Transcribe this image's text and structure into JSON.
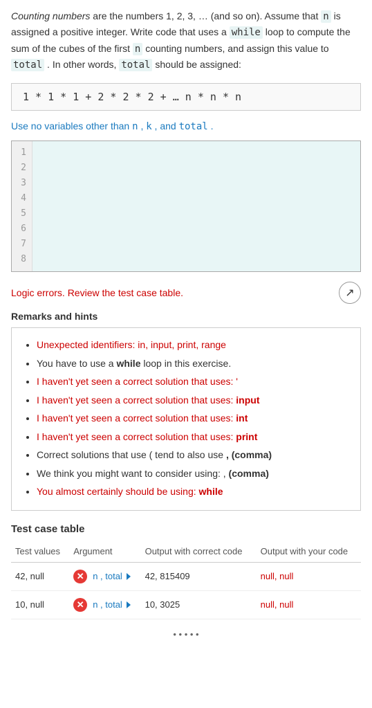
{
  "description": {
    "intro": "Counting numbers are the numbers 1, 2, 3, … (and so on). Assume that ",
    "var_n": "n",
    "mid": " is assigned a positive integer. Write code that uses a ",
    "while_kw": "while",
    "mid2": " loop to compute the sum of the cubes of the first ",
    "var_n2": "n",
    "mid3": " counting numbers, and assign this value to ",
    "total_kw": "total",
    "end": ". In other words, ",
    "total_kw2": "total",
    "end2": " should be assigned:"
  },
  "formula": "1 * 1 * 1 + 2 * 2 * 2 + … n * n * n",
  "constraint": {
    "prefix": "Use no variables other than ",
    "n": "n",
    "comma1": ",  ",
    "k": "k",
    "comma2": ", and ",
    "total": "total",
    "period": "."
  },
  "editor": {
    "lines": [
      "1",
      "2",
      "3",
      "4",
      "5",
      "6",
      "7",
      "8"
    ]
  },
  "error": {
    "text": "Logic errors. Review the test case table.",
    "expand_icon": "↗"
  },
  "remarks": {
    "title": "Remarks and hints",
    "items": [
      {
        "prefix": "Unexpected identifiers: ",
        "text": "in, input, print, range",
        "style": "red"
      },
      {
        "prefix": "You have to use a ",
        "bold": "while",
        "suffix": " loop in this exercise.",
        "style": "normal"
      },
      {
        "prefix": "I haven't yet seen a correct solution that uses: ",
        "text": "'",
        "style": "red"
      },
      {
        "prefix": "I haven't yet seen a correct solution that uses: ",
        "bold": "input",
        "style": "red"
      },
      {
        "prefix": "I haven't yet seen a correct solution that uses: ",
        "bold": "int",
        "style": "red"
      },
      {
        "prefix": "I haven't yet seen a correct solution that uses: ",
        "bold": "print",
        "style": "red"
      },
      {
        "prefix": "Correct solutions that use ",
        "text": "( tend to also use ",
        "bold2": ", (comma)",
        "style": "normal"
      },
      {
        "prefix": "We think you might want to consider using: ",
        "text": ", ",
        "bold2": "(comma)",
        "style": "normal"
      },
      {
        "prefix": "You almost certainly should be using: ",
        "bold": "while",
        "style": "red"
      }
    ]
  },
  "test_table": {
    "title": "Test case table",
    "headers": [
      "Test values",
      "Argument",
      "Output with correct code",
      "Output with your code"
    ],
    "rows": [
      {
        "test_values": "42, null",
        "argument": "n , total",
        "correct_output": "42, 815409",
        "your_output": "null, null",
        "status": "error"
      },
      {
        "test_values": "10, null",
        "argument": "n , total",
        "correct_output": "10, 3025",
        "your_output": "null, null",
        "status": "error"
      }
    ]
  },
  "pagination": {
    "dots": "• • • • •"
  }
}
